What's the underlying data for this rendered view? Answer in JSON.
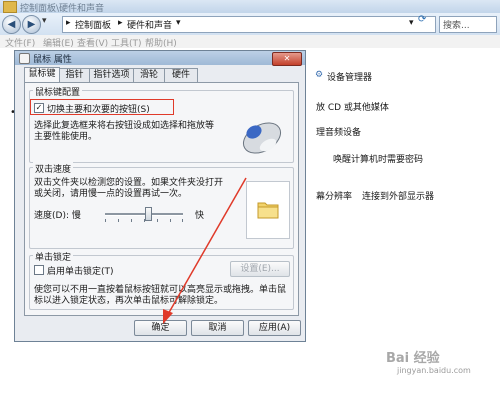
{
  "window": {
    "title": "控制面板\\硬件和声音"
  },
  "address": {
    "crumb1": "控制面板",
    "crumb2": "硬件和声音",
    "search_placeholder": "搜索..."
  },
  "menu": {
    "items": [
      "文件(F)",
      "编辑(E)",
      "查看(V)",
      "工具(T)",
      "帮助(H)"
    ]
  },
  "right": {
    "device_manager": "设备管理器",
    "cd_auto": "放 CD 或其他媒体",
    "sound": "理音频设备",
    "wake": "唤醒计算机时需要密码",
    "res": "幕分辨率",
    "external": "连接到外部显示器"
  },
  "dialog": {
    "title": "鼠标 属性",
    "close": "✕",
    "tabs": [
      "鼠标键",
      "指针",
      "指针选项",
      "滑轮",
      "硬件"
    ],
    "buttons_group": {
      "label": "鼠标键配置",
      "checkbox": "切换主要和次要的按钮(S)",
      "checked_mark": "✓",
      "desc1": "选择此复选框来将右按钮设成如选择和拖放等",
      "desc2": "主要性能使用。"
    },
    "dblclick_group": {
      "label": "双击速度",
      "desc1": "双击文件夹以检测您的设置。如果文件夹没打开",
      "desc2": "或关闭，请用慢一点的设置再试一次。",
      "speed_label": "速度(D): 慢",
      "fast_label": "快",
      "speed_value": 0.55
    },
    "clicklock_group": {
      "label": "单击锁定",
      "checkbox": "启用单击锁定(T)",
      "settings_button": "设置(E)...",
      "desc1": "使您可以不用一直按着鼠标按钮就可以高亮显示或拖拽。单击鼠",
      "desc2": "标以进入锁定状态，再次单击鼠标可解除锁定。"
    },
    "footer": {
      "ok": "确定",
      "cancel": "取消",
      "apply": "应用(A)"
    }
  },
  "watermark": {
    "line1": "Bai 经验",
    "line2": "jingyan.baidu.com"
  },
  "colors": {
    "highlight": "#e03a2a",
    "arrow": "#e03a2a"
  }
}
